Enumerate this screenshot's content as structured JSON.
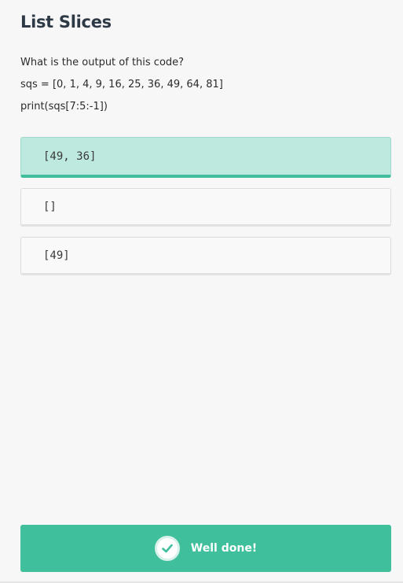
{
  "lesson": {
    "title": "List Slices"
  },
  "question": {
    "prompt": "What is the output of this code?",
    "code_lines": [
      "sqs = [0, 1, 4, 9, 16, 25, 36, 49, 64, 81]",
      "print(sqs[7:5:-1])"
    ]
  },
  "options": [
    {
      "label": "[49, 36]",
      "state": "correct"
    },
    {
      "label": "[]",
      "state": "default"
    },
    {
      "label": "[49]",
      "state": "default"
    }
  ],
  "feedback": {
    "message": "Well done!",
    "icon": "check-icon"
  },
  "colors": {
    "accent": "#3fbf9b",
    "correct_bg": "#bde9df",
    "title": "#2d3a46",
    "background": "#f7f7f7"
  }
}
